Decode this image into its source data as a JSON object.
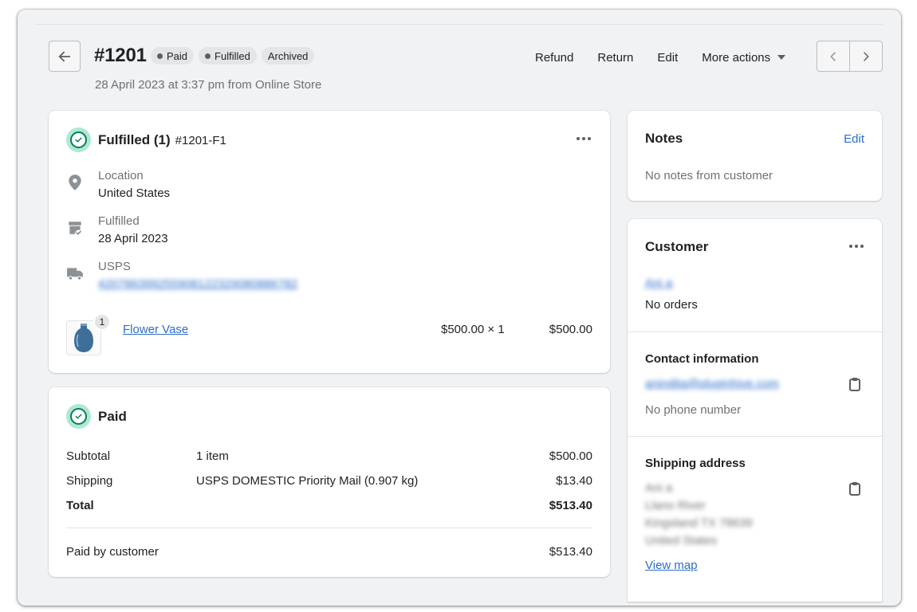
{
  "header": {
    "order_number": "#1201",
    "badges": [
      {
        "label": "Paid",
        "dot": true
      },
      {
        "label": "Fulfilled",
        "dot": true
      },
      {
        "label": "Archived",
        "dot": false
      }
    ],
    "subtitle": "28 April 2023 at 3:37 pm from Online Store",
    "actions": {
      "refund": "Refund",
      "return": "Return",
      "edit": "Edit",
      "more": "More actions"
    }
  },
  "fulfillment": {
    "title": "Fulfilled (1)",
    "fulfillment_id": "#1201-F1",
    "location_label": "Location",
    "location_value": "United States",
    "fulfilled_label": "Fulfilled",
    "fulfilled_value": "28 April 2023",
    "carrier_label": "USPS",
    "tracking_number": "420786399255908122329080886782",
    "item": {
      "name": "Flower Vase",
      "quantity_badge": "1",
      "unit_price": "$500.00 × 1",
      "line_total": "$500.00"
    }
  },
  "payment": {
    "title": "Paid",
    "subtotal_label": "Subtotal",
    "subtotal_desc": "1 item",
    "subtotal_value": "$500.00",
    "shipping_label": "Shipping",
    "shipping_desc": "USPS DOMESTIC Priority Mail (0.907 kg)",
    "shipping_value": "$13.40",
    "total_label": "Total",
    "total_value": "$513.40",
    "paid_by_label": "Paid by customer",
    "paid_by_value": "$513.40"
  },
  "notes": {
    "title": "Notes",
    "edit": "Edit",
    "text": "No notes from customer"
  },
  "customer": {
    "title": "Customer",
    "name": "Ani a",
    "orders": "No orders",
    "contact_title": "Contact information",
    "email": "anindita@pluginhive.com",
    "phone": "No phone number",
    "shipping_title": "Shipping address",
    "address_lines": [
      "Ani a",
      "Llano River",
      "Kingsland TX 78639",
      "United States"
    ],
    "view_map": "View map"
  },
  "colors": {
    "link": "#2c6ecb",
    "success_bg": "#aee9d1",
    "success_ring": "#007f5f",
    "page_bg": "#f1f2f4"
  }
}
